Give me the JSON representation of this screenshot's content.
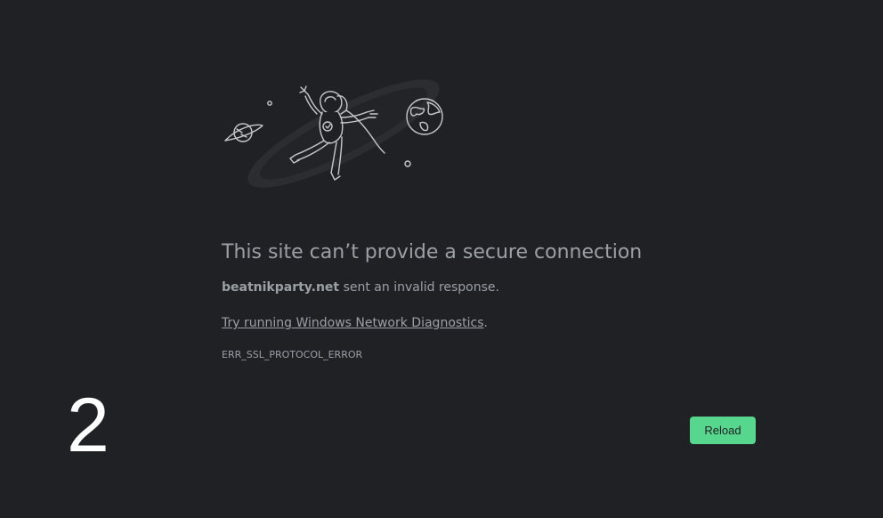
{
  "error_page": {
    "title": "This site can’t provide a secure connection",
    "summary_domain": "beatnikparty.net",
    "summary_rest": " sent an invalid response.",
    "suggestion_link": "Try running Windows Network Diagnostics",
    "suggestion_period": ".",
    "error_code": "ERR_SSL_PROTOCOL_ERROR",
    "reload_label": "Reload"
  },
  "overlay": {
    "number": "2"
  },
  "colors": {
    "background": "#202124",
    "text": "#9aa0a6",
    "button": "#57d68d",
    "overlay_number": "#ffffff"
  },
  "icons": {
    "illustration": "astronaut-space-illustration-icon"
  }
}
